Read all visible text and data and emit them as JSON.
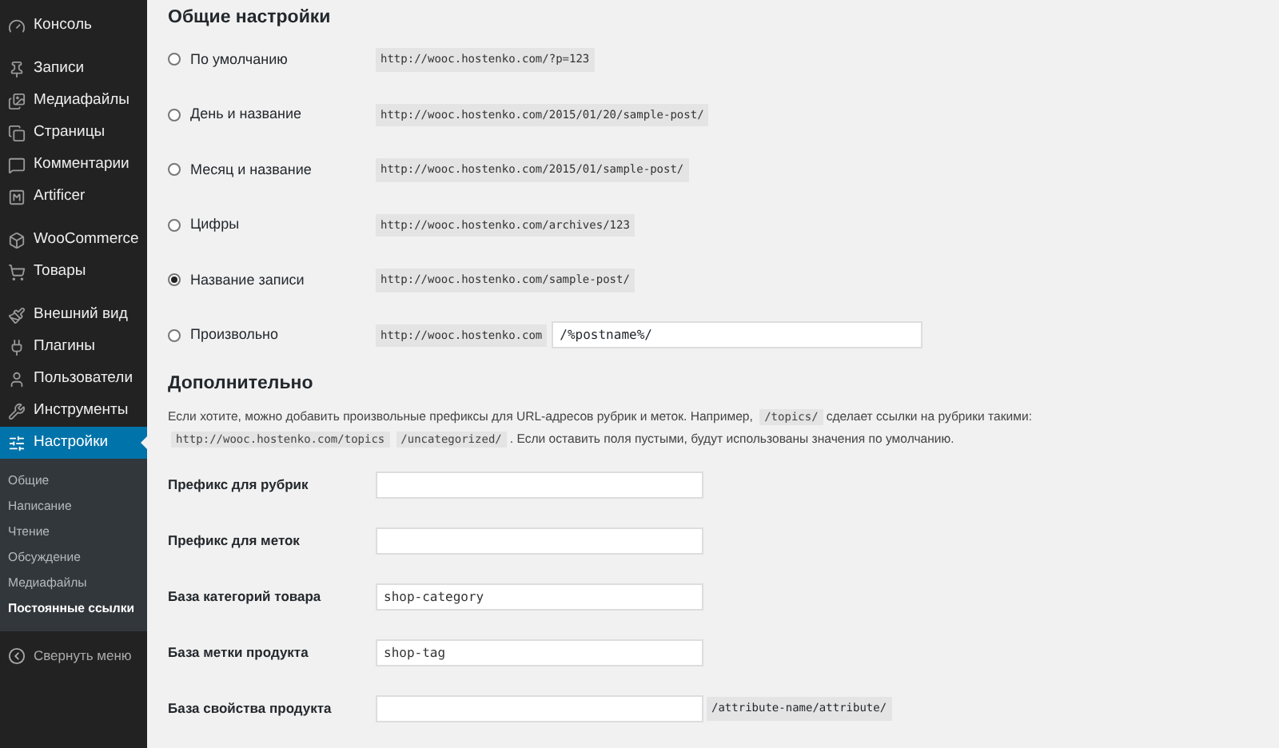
{
  "sidebar": {
    "groups": [
      [
        {
          "label": "Консоль",
          "selected": false
        }
      ],
      [
        {
          "label": "Записи",
          "selected": false
        },
        {
          "label": "Медиафайлы",
          "selected": false
        },
        {
          "label": "Страницы",
          "selected": false
        },
        {
          "label": "Комментарии",
          "selected": false
        },
        {
          "label": "Artificer",
          "selected": false
        }
      ],
      [
        {
          "label": "WooCommerce",
          "selected": false
        },
        {
          "label": "Товары",
          "selected": false
        }
      ],
      [
        {
          "label": "Внешний вид",
          "selected": false
        },
        {
          "label": "Плагины",
          "selected": false
        },
        {
          "label": "Пользователи",
          "selected": false
        },
        {
          "label": "Инструменты",
          "selected": false
        },
        {
          "label": "Настройки",
          "selected": true
        }
      ]
    ],
    "submenu": [
      {
        "label": "Общие",
        "selected": false
      },
      {
        "label": "Написание",
        "selected": false
      },
      {
        "label": "Чтение",
        "selected": false
      },
      {
        "label": "Обсуждение",
        "selected": false
      },
      {
        "label": "Медиафайлы",
        "selected": false
      },
      {
        "label": "Постоянные ссылки",
        "selected": true
      }
    ],
    "collapse": "Свернуть меню"
  },
  "common": {
    "title": "Общие настройки",
    "options": [
      {
        "label": "По умолчанию",
        "selected": false,
        "example": "http://wooc.hostenko.com/?p=123"
      },
      {
        "label": "День и название",
        "selected": false,
        "example": "http://wooc.hostenko.com/2015/01/20/sample-post/"
      },
      {
        "label": "Месяц и название",
        "selected": false,
        "example": "http://wooc.hostenko.com/2015/01/sample-post/"
      },
      {
        "label": "Цифры",
        "selected": false,
        "example": "http://wooc.hostenko.com/archives/123"
      },
      {
        "label": "Название записи",
        "selected": true,
        "example": "http://wooc.hostenko.com/sample-post/"
      },
      {
        "label": "Произвольно",
        "selected": false,
        "example": "http://wooc.hostenko.com",
        "value": "/%postname%/"
      }
    ]
  },
  "optional": {
    "title": "Дополнительно",
    "description": [
      {
        "kind": "text",
        "text": "Если хотите, можно добавить произвольные префиксы для URL-адресов рубрик и меток. Например,"
      },
      {
        "kind": "code",
        "text": "/topics/"
      },
      {
        "kind": "text",
        "text": "сделает ссылки на рубрики такими:"
      },
      {
        "kind": "code",
        "text": "http://wooc.hostenko.com/topics"
      },
      {
        "kind": "code",
        "text": "/uncategorized/"
      },
      {
        "kind": "text",
        "text": ". Если оставить поля пустыми, будут использованы значения по умолчанию."
      }
    ],
    "fields": [
      {
        "label": "Префикс для рубрик"
      },
      {
        "label": "Префикс для меток"
      },
      {
        "label": "База категорий товара",
        "value": "shop-category"
      },
      {
        "label": "База метки продукта",
        "value": "shop-tag"
      },
      {
        "label": "База свойства продукта",
        "suffix": "/attribute-name/attribute/"
      }
    ]
  }
}
